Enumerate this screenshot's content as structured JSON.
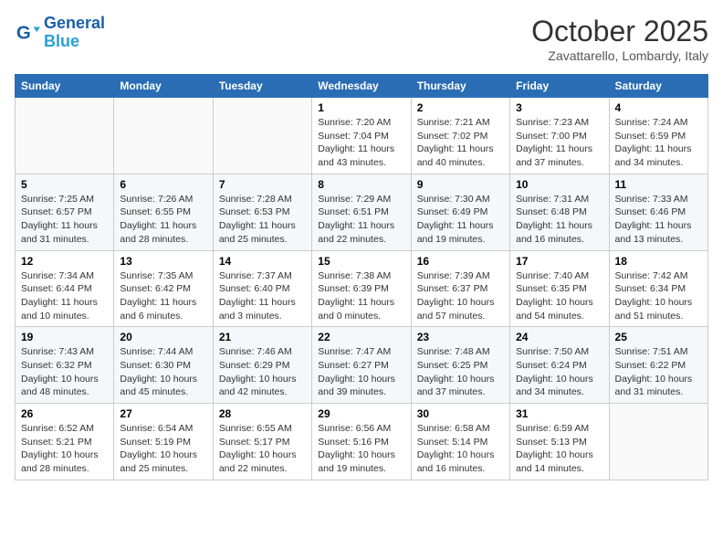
{
  "header": {
    "logo_line1": "General",
    "logo_line2": "Blue",
    "month": "October 2025",
    "location": "Zavattarello, Lombardy, Italy"
  },
  "days_of_week": [
    "Sunday",
    "Monday",
    "Tuesday",
    "Wednesday",
    "Thursday",
    "Friday",
    "Saturday"
  ],
  "weeks": [
    [
      {
        "day": "",
        "info": ""
      },
      {
        "day": "",
        "info": ""
      },
      {
        "day": "",
        "info": ""
      },
      {
        "day": "1",
        "info": "Sunrise: 7:20 AM\nSunset: 7:04 PM\nDaylight: 11 hours and 43 minutes."
      },
      {
        "day": "2",
        "info": "Sunrise: 7:21 AM\nSunset: 7:02 PM\nDaylight: 11 hours and 40 minutes."
      },
      {
        "day": "3",
        "info": "Sunrise: 7:23 AM\nSunset: 7:00 PM\nDaylight: 11 hours and 37 minutes."
      },
      {
        "day": "4",
        "info": "Sunrise: 7:24 AM\nSunset: 6:59 PM\nDaylight: 11 hours and 34 minutes."
      }
    ],
    [
      {
        "day": "5",
        "info": "Sunrise: 7:25 AM\nSunset: 6:57 PM\nDaylight: 11 hours and 31 minutes."
      },
      {
        "day": "6",
        "info": "Sunrise: 7:26 AM\nSunset: 6:55 PM\nDaylight: 11 hours and 28 minutes."
      },
      {
        "day": "7",
        "info": "Sunrise: 7:28 AM\nSunset: 6:53 PM\nDaylight: 11 hours and 25 minutes."
      },
      {
        "day": "8",
        "info": "Sunrise: 7:29 AM\nSunset: 6:51 PM\nDaylight: 11 hours and 22 minutes."
      },
      {
        "day": "9",
        "info": "Sunrise: 7:30 AM\nSunset: 6:49 PM\nDaylight: 11 hours and 19 minutes."
      },
      {
        "day": "10",
        "info": "Sunrise: 7:31 AM\nSunset: 6:48 PM\nDaylight: 11 hours and 16 minutes."
      },
      {
        "day": "11",
        "info": "Sunrise: 7:33 AM\nSunset: 6:46 PM\nDaylight: 11 hours and 13 minutes."
      }
    ],
    [
      {
        "day": "12",
        "info": "Sunrise: 7:34 AM\nSunset: 6:44 PM\nDaylight: 11 hours and 10 minutes."
      },
      {
        "day": "13",
        "info": "Sunrise: 7:35 AM\nSunset: 6:42 PM\nDaylight: 11 hours and 6 minutes."
      },
      {
        "day": "14",
        "info": "Sunrise: 7:37 AM\nSunset: 6:40 PM\nDaylight: 11 hours and 3 minutes."
      },
      {
        "day": "15",
        "info": "Sunrise: 7:38 AM\nSunset: 6:39 PM\nDaylight: 11 hours and 0 minutes."
      },
      {
        "day": "16",
        "info": "Sunrise: 7:39 AM\nSunset: 6:37 PM\nDaylight: 10 hours and 57 minutes."
      },
      {
        "day": "17",
        "info": "Sunrise: 7:40 AM\nSunset: 6:35 PM\nDaylight: 10 hours and 54 minutes."
      },
      {
        "day": "18",
        "info": "Sunrise: 7:42 AM\nSunset: 6:34 PM\nDaylight: 10 hours and 51 minutes."
      }
    ],
    [
      {
        "day": "19",
        "info": "Sunrise: 7:43 AM\nSunset: 6:32 PM\nDaylight: 10 hours and 48 minutes."
      },
      {
        "day": "20",
        "info": "Sunrise: 7:44 AM\nSunset: 6:30 PM\nDaylight: 10 hours and 45 minutes."
      },
      {
        "day": "21",
        "info": "Sunrise: 7:46 AM\nSunset: 6:29 PM\nDaylight: 10 hours and 42 minutes."
      },
      {
        "day": "22",
        "info": "Sunrise: 7:47 AM\nSunset: 6:27 PM\nDaylight: 10 hours and 39 minutes."
      },
      {
        "day": "23",
        "info": "Sunrise: 7:48 AM\nSunset: 6:25 PM\nDaylight: 10 hours and 37 minutes."
      },
      {
        "day": "24",
        "info": "Sunrise: 7:50 AM\nSunset: 6:24 PM\nDaylight: 10 hours and 34 minutes."
      },
      {
        "day": "25",
        "info": "Sunrise: 7:51 AM\nSunset: 6:22 PM\nDaylight: 10 hours and 31 minutes."
      }
    ],
    [
      {
        "day": "26",
        "info": "Sunrise: 6:52 AM\nSunset: 5:21 PM\nDaylight: 10 hours and 28 minutes."
      },
      {
        "day": "27",
        "info": "Sunrise: 6:54 AM\nSunset: 5:19 PM\nDaylight: 10 hours and 25 minutes."
      },
      {
        "day": "28",
        "info": "Sunrise: 6:55 AM\nSunset: 5:17 PM\nDaylight: 10 hours and 22 minutes."
      },
      {
        "day": "29",
        "info": "Sunrise: 6:56 AM\nSunset: 5:16 PM\nDaylight: 10 hours and 19 minutes."
      },
      {
        "day": "30",
        "info": "Sunrise: 6:58 AM\nSunset: 5:14 PM\nDaylight: 10 hours and 16 minutes."
      },
      {
        "day": "31",
        "info": "Sunrise: 6:59 AM\nSunset: 5:13 PM\nDaylight: 10 hours and 14 minutes."
      },
      {
        "day": "",
        "info": ""
      }
    ]
  ]
}
